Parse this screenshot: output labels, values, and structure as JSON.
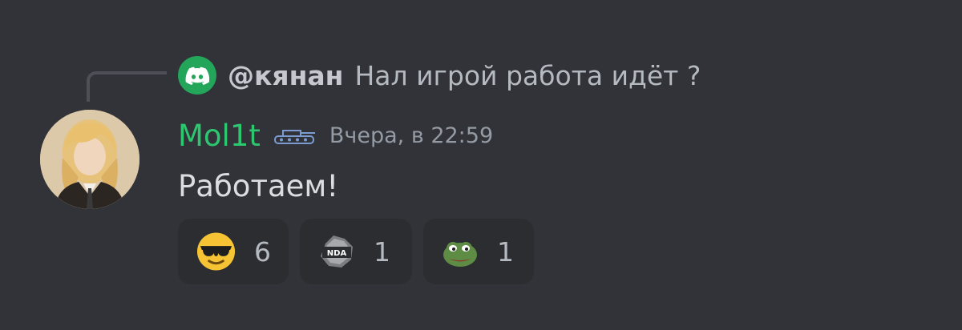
{
  "reply": {
    "author": "@кянан",
    "text": "Нал игрой работа идёт ?",
    "avatar_color": "#23a55a",
    "avatar_icon": "discord-logo-icon"
  },
  "message": {
    "username": "Mol1t",
    "username_color": "#2dc770",
    "role_icon": "tank-icon",
    "timestamp": "Вчера, в 22:59",
    "content": "Работаем!"
  },
  "reactions": [
    {
      "emoji": "sunglasses-emoji-icon",
      "count": "6"
    },
    {
      "emoji": "nda-emoji-icon",
      "count": "1"
    },
    {
      "emoji": "pepe-emoji-icon",
      "count": "1"
    }
  ],
  "colors": {
    "background": "#313338",
    "reaction_background": "#2b2d31",
    "text": "#dbdee1",
    "muted": "#949ba4"
  }
}
